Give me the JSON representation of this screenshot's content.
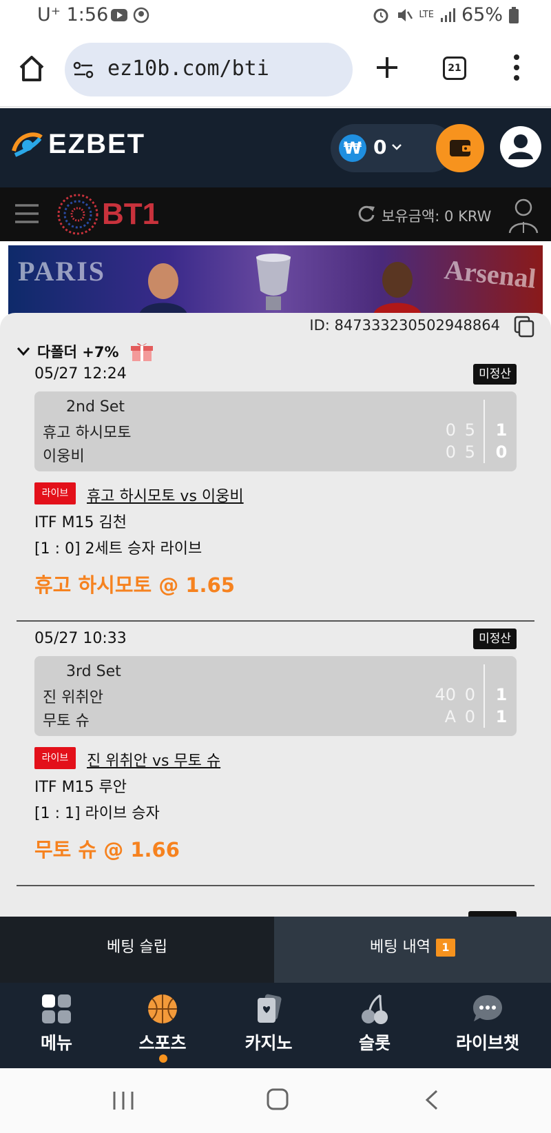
{
  "status_bar": {
    "carrier": "U⁺",
    "time": "1:56",
    "network": "LTE",
    "battery": "65%"
  },
  "browser": {
    "url": "ez10b.com/bti",
    "tab_count": "21"
  },
  "header": {
    "logo": "EZBET",
    "balance": "0",
    "currency_symbol": "₩"
  },
  "bti_bar": {
    "logo": "BT1",
    "holding_label": "보유금액: 0 KRW"
  },
  "banner": {
    "left_text": "PARIS",
    "right_text": "Arsenal"
  },
  "history": {
    "id_text": "ID: 847333230502948864",
    "multi_label": "다폴더 +7%",
    "bets": [
      {
        "date": "05/27 12:24",
        "status": "미정산",
        "set_label": "2nd Set",
        "team1": "휴고 하시모토",
        "team2": "이웅비",
        "team1_points": [
          "0",
          "5"
        ],
        "team2_points": [
          "0",
          "5"
        ],
        "team1_sets": "1",
        "team2_sets": "0",
        "live_label": "라이브",
        "match": "휴고 하시모토 vs 이웅비",
        "league": "ITF M15 김천",
        "market": "[1 : 0] 2세트 승자 라이브",
        "pick": "휴고 하시모토 @ 1.65"
      },
      {
        "date": "05/27 10:33",
        "status": "미정산",
        "set_label": "3rd Set",
        "team1": "진 위취안",
        "team2": "무토 슈",
        "team1_points": [
          "40",
          "0"
        ],
        "team2_points": [
          "A",
          "0"
        ],
        "team1_sets": "1",
        "team2_sets": "1",
        "live_label": "라이브",
        "match": "진 위취안 vs 무토 슈",
        "league": "ITF M15 루안",
        "market": "[1 : 1] 라이브 승자",
        "pick": "무토 슈 @ 1.66"
      }
    ]
  },
  "slip_tabs": {
    "slip": "베팅 슬립",
    "history": "베팅 내역",
    "history_count": "1"
  },
  "bottom_nav": {
    "items": [
      {
        "label": "메뉴",
        "icon": "grid-icon"
      },
      {
        "label": "스포츠",
        "icon": "basketball-icon"
      },
      {
        "label": "카지노",
        "icon": "cards-icon"
      },
      {
        "label": "슬롯",
        "icon": "cherry-icon"
      },
      {
        "label": "라이브챗",
        "icon": "chat-icon"
      }
    ]
  },
  "colors": {
    "accent": "#f7931e",
    "header_bg": "#15202e",
    "live_red": "#e3101a",
    "pick_orange": "#f6821f"
  }
}
